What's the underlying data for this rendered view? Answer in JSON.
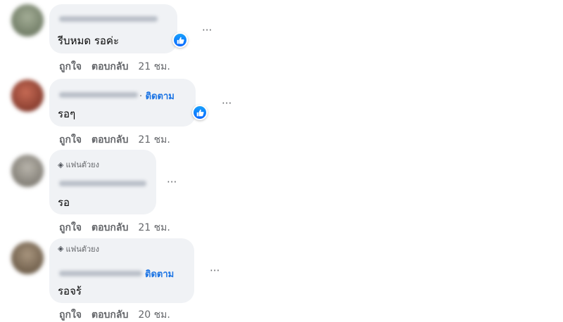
{
  "comments": [
    {
      "text": "รีบหมด รอค่ะ",
      "has_like_reaction": true,
      "actions": {
        "like": "ถูกใจ",
        "reply": "ตอบกลับ",
        "time": "21 ชม."
      },
      "avatar_color": "#7a8a6f"
    },
    {
      "follow_label": "ติดตาม",
      "separator": "·",
      "text": "รอๆ",
      "has_like_reaction": true,
      "actions": {
        "like": "ถูกใจ",
        "reply": "ตอบกลับ",
        "time": "21 ชม."
      },
      "avatar_color": "#9b4a3a"
    },
    {
      "badge": "แฟนตัวยง",
      "text": "รอ",
      "actions": {
        "like": "ถูกใจ",
        "reply": "ตอบกลับ",
        "time": "21 ชม."
      },
      "avatar_color": "#8f8a80"
    },
    {
      "badge": "แฟนตัวยง",
      "follow_label": "ติดตาม",
      "text": "รอจร้",
      "actions": {
        "like": "ถูกใจ",
        "reply": "ตอบกลับ",
        "time": "20 ชม."
      },
      "avatar_color": "#7d6a55"
    }
  ],
  "icons": {
    "more": "···",
    "like_reaction": "thumbs-up-icon",
    "fan_badge": "gem-icon"
  },
  "colors": {
    "bubble": "#f0f2f5",
    "link": "#1b74e4",
    "muted": "#65676b",
    "reaction": "#0866ff"
  }
}
